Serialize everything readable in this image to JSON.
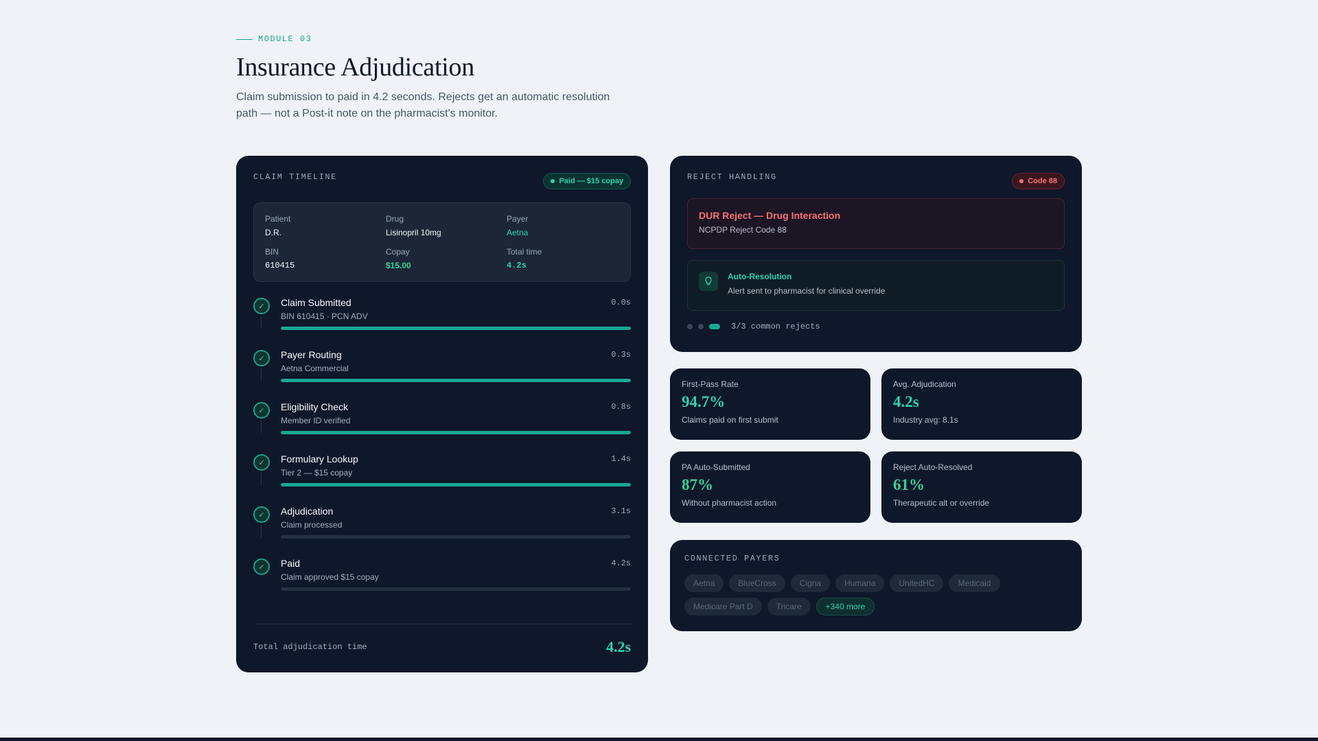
{
  "header": {
    "eyebrow": "MODULE 03",
    "title": "Insurance Adjudication",
    "subtitle": "Claim submission to paid in 4.2 seconds. Rejects get an automatic resolution path — not a Post-it note on the pharmacist's monitor."
  },
  "colors": {
    "accent": "#2fd3b1",
    "success": "#34d399",
    "danger": "#f87171",
    "panel": "#0f172a",
    "page": "#eff3f8"
  },
  "timeline": {
    "label": "CLAIM TIMELINE",
    "status": "Paid — $15 copay",
    "claim": {
      "patient_label": "Patient",
      "patient": "D.R.",
      "drug_label": "Drug",
      "drug": "Lisinopril 10mg",
      "payer_label": "Payer",
      "payer": "Aetna",
      "bin_label": "BIN",
      "bin": "610415",
      "copay_label": "Copay",
      "copay": "$15.00",
      "total_label": "Total time",
      "total": "4.2s"
    },
    "steps": [
      {
        "title": "Claim Submitted",
        "sub": "BIN 610415 · PCN ADV",
        "time": "0.0s",
        "progress": 1
      },
      {
        "title": "Payer Routing",
        "sub": "Aetna Commercial",
        "time": "0.3s",
        "progress": 1
      },
      {
        "title": "Eligibility Check",
        "sub": "Member ID verified",
        "time": "0.8s",
        "progress": 1
      },
      {
        "title": "Formulary Lookup",
        "sub": "Tier 2 — $15 copay",
        "time": "1.4s",
        "progress": 1
      },
      {
        "title": "Adjudication",
        "sub": "Claim processed",
        "time": "3.1s",
        "progress": 0
      },
      {
        "title": "Paid",
        "sub": "Claim approved $15 copay",
        "time": "4.2s",
        "progress": 0
      }
    ],
    "total_label": "Total adjudication time",
    "total_value": "4.2s"
  },
  "reject": {
    "label": "REJECT HANDLING",
    "badge": "Code 88",
    "title": "DUR Reject — Drug Interaction",
    "sub": "NCPDP Reject Code 88",
    "auto_title": "Auto-Resolution",
    "auto_sub": "Alert sent to pharmacist for clinical override",
    "pager_text": "3/3 common rejects",
    "pager_active": 3
  },
  "stats": {
    "fpr": {
      "label": "First-Pass Rate",
      "value": "94.7%",
      "sub": "Claims paid on first submit",
      "color": "#2fd3b1"
    },
    "avg": {
      "label": "Avg. Adjudication",
      "value": "4.2s",
      "sub": "Industry avg: 8.1s",
      "color": "#2fd3b1"
    },
    "pa": {
      "label": "PA Auto-Submitted",
      "value": "87%",
      "sub": "Without pharmacist action",
      "color": "#34d399"
    },
    "rej": {
      "label": "Reject Auto-Resolved",
      "value": "61%",
      "sub": "Therapeutic alt or override",
      "color": "#34d399"
    }
  },
  "payers": {
    "label": "CONNECTED PAYERS",
    "items": [
      "Aetna",
      "BlueCross",
      "Cigna",
      "Humana",
      "UnitedHC",
      "Medicaid",
      "Medicare Part D",
      "Tricare"
    ],
    "more": "+340 more"
  }
}
